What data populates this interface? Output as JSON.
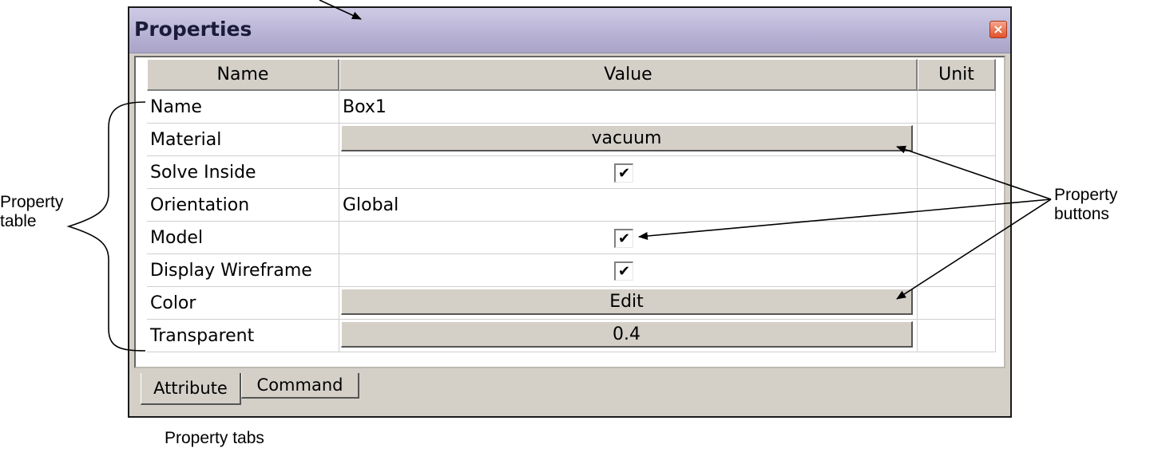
{
  "window": {
    "title": "Properties",
    "close_glyph": "×",
    "accent_color": "#e2522a"
  },
  "table": {
    "headers": {
      "name": "Name",
      "value": "Value",
      "unit": "Unit"
    },
    "rows": [
      {
        "name": "Name",
        "kind": "text",
        "value": "Box1",
        "unit": ""
      },
      {
        "name": "Material",
        "kind": "button",
        "value": "vacuum",
        "unit": ""
      },
      {
        "name": "Solve Inside",
        "kind": "checkbox",
        "value": "✔",
        "unit": ""
      },
      {
        "name": "Orientation",
        "kind": "text",
        "value": "Global",
        "unit": ""
      },
      {
        "name": "Model",
        "kind": "checkbox",
        "value": "✔",
        "unit": ""
      },
      {
        "name": "Display Wireframe",
        "kind": "checkbox",
        "value": "✔",
        "unit": ""
      },
      {
        "name": "Color",
        "kind": "button",
        "value": "Edit",
        "unit": ""
      },
      {
        "name": "Transparent",
        "kind": "button",
        "value": "0.4",
        "unit": ""
      }
    ]
  },
  "tabs": [
    {
      "label": "Attribute",
      "active": true
    },
    {
      "label": "Command",
      "active": false
    }
  ],
  "annotations": {
    "property_table": "Property\ntable",
    "property_buttons": "Property\nbuttons",
    "property_tabs": "Property tabs"
  }
}
